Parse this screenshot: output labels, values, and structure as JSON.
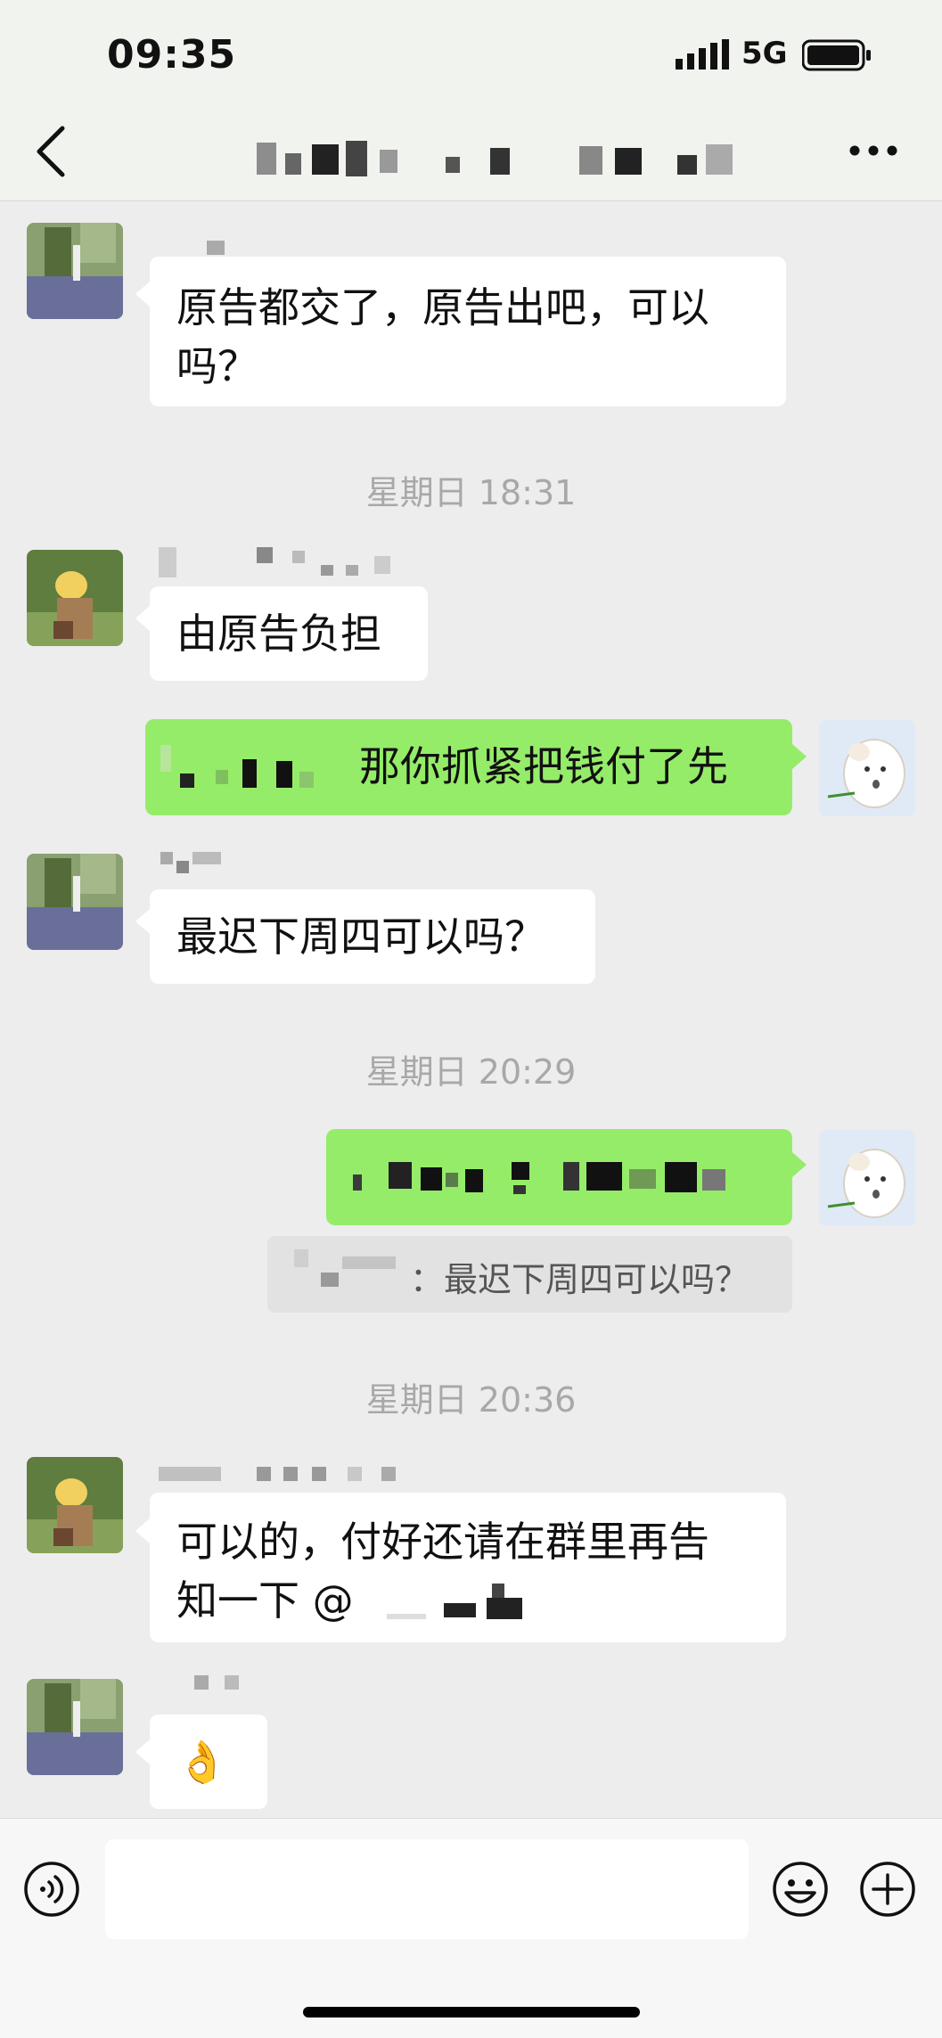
{
  "status_bar": {
    "time": "09:35",
    "network": "5G"
  },
  "header": {
    "back_icon": "chevron-left-icon",
    "more_icon": "more-dots-icon"
  },
  "messages": [
    {
      "side": "left",
      "text_line1": "原告都交了，原告出吧，可以",
      "text_line2": "吗？"
    },
    {
      "type": "timestamp",
      "text": "星期日 18:31"
    },
    {
      "side": "left",
      "text": "由原告负担"
    },
    {
      "side": "right",
      "text": "那你抓紧把钱付了先"
    },
    {
      "side": "left",
      "text": "最迟下周四可以吗？"
    },
    {
      "type": "timestamp",
      "text": "星期日 20:29"
    },
    {
      "side": "right",
      "text": ""
    },
    {
      "type": "quote",
      "sep": "：",
      "text": "最迟下周四可以吗？"
    },
    {
      "type": "timestamp",
      "text": "星期日 20:36"
    },
    {
      "side": "left",
      "text_line1": "可以的，付好还请在群里再告",
      "text_line2_prefix": "知一下 @"
    },
    {
      "side": "left",
      "text": "👌"
    }
  ],
  "input_bar": {
    "voice_icon": "voice-icon",
    "emoji_icon": "emoji-icon",
    "plus_icon": "plus-icon"
  },
  "colors": {
    "my_bubble": "#95ec69",
    "other_bubble": "#ffffff",
    "background": "#ededed"
  }
}
